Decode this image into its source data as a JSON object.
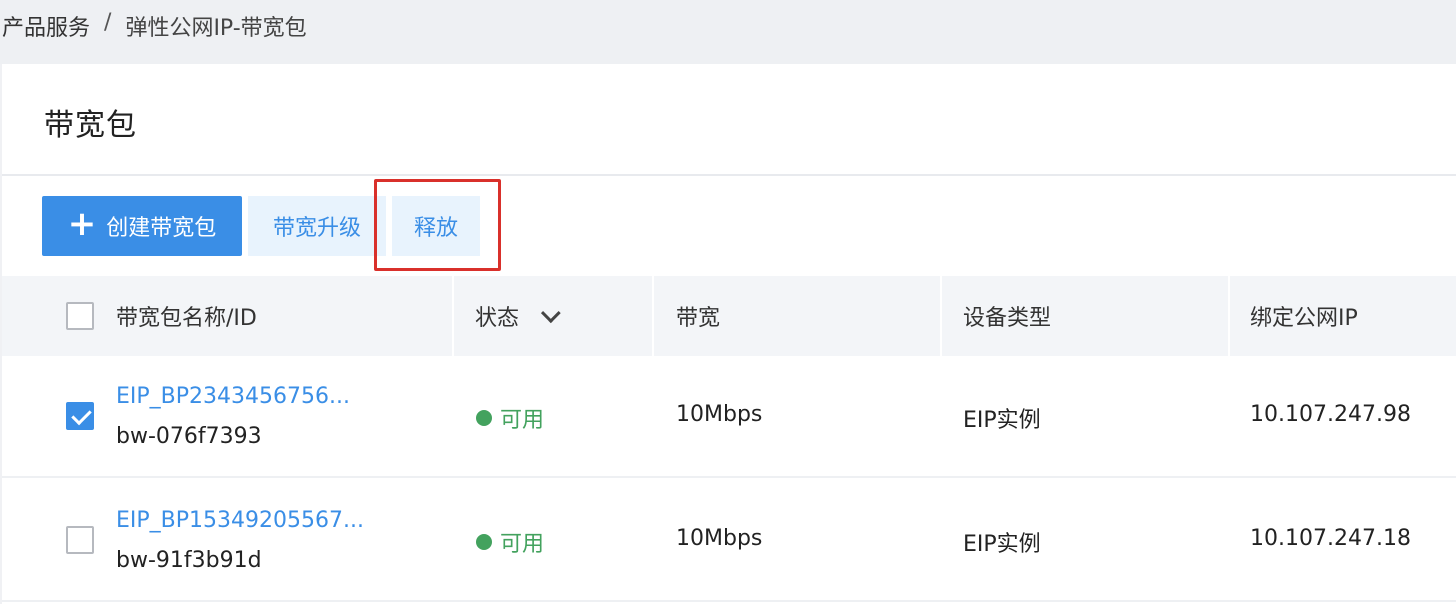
{
  "breadcrumb": {
    "parent": "产品服务",
    "separator": "/",
    "current": "弹性公网IP-带宽包"
  },
  "page": {
    "title": "带宽包"
  },
  "toolbar": {
    "create_icon": "plus-icon",
    "create_label": "创建带宽包",
    "upgrade_label": "带宽升级",
    "release_label": "释放"
  },
  "table": {
    "columns": {
      "name_id": "带宽包名称/ID",
      "status": "状态",
      "bandwidth": "带宽",
      "device_type": "设备类型",
      "bound_ip": "绑定公网IP"
    },
    "rows": [
      {
        "checked": true,
        "name": "EIP_BP2343456756...",
        "id": "bw-076f7393",
        "status": "可用",
        "bandwidth": "10Mbps",
        "device_type": "EIP实例",
        "bound_ip": "10.107.247.98"
      },
      {
        "checked": false,
        "name": "EIP_BP15349205567...",
        "id": "bw-91f3b91d",
        "status": "可用",
        "bandwidth": "10Mbps",
        "device_type": "EIP实例",
        "bound_ip": "10.107.247.18"
      }
    ]
  },
  "colors": {
    "primary": "#3a8ee6",
    "status_available": "#43a25e",
    "highlight": "#d9302b"
  }
}
